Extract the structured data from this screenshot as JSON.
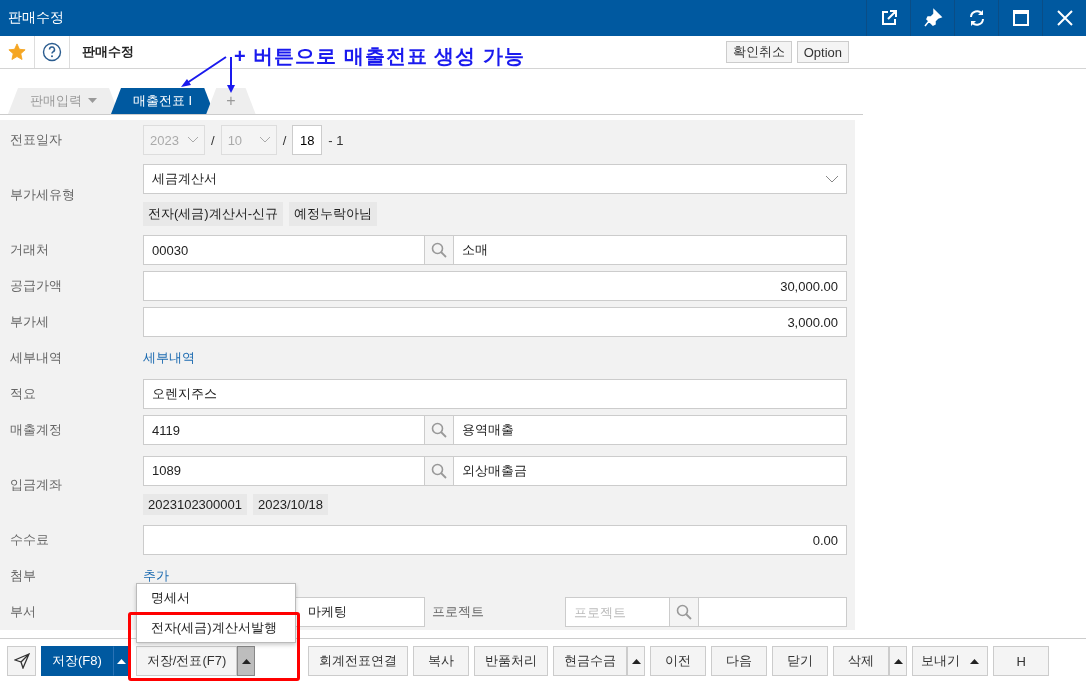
{
  "window": {
    "title": "판매수정"
  },
  "toolbar": {
    "favorite": true,
    "title": "판매수정",
    "buttons": [
      "확인취소",
      "Option"
    ]
  },
  "annotation": {
    "text": "+ 버튼으로 매출전표 생성 가능"
  },
  "tabs": [
    {
      "label": "판매입력",
      "selected": false,
      "kind": "dropdown"
    },
    {
      "label": "매출전표 I",
      "selected": true,
      "kind": "plain"
    },
    {
      "label": "+",
      "selected": false,
      "kind": "add"
    }
  ],
  "form": [
    {
      "kind": "date",
      "label": "전표일자",
      "year": "2023",
      "month": "10",
      "day": "18",
      "separator": "/",
      "suffix": "- 1"
    },
    {
      "kind": "select",
      "label": "부가세유형",
      "value": "세금계산서",
      "chips": [
        "전자(세금)계산서-신규",
        "예정누락아님"
      ]
    },
    {
      "kind": "lookup",
      "label": "거래처",
      "code": "00030",
      "name": "소매"
    },
    {
      "kind": "amount",
      "label": "공급가액",
      "value": "30,000.00"
    },
    {
      "kind": "amount",
      "label": "부가세",
      "value": "3,000.00"
    },
    {
      "kind": "link",
      "label": "세부내역",
      "value": "세부내역"
    },
    {
      "kind": "text",
      "label": "적요",
      "value": "오렌지주스"
    },
    {
      "kind": "lookup",
      "label": "매출계정",
      "code": "4119",
      "name": "용역매출"
    },
    {
      "kind": "lookup",
      "label": "입금계좌",
      "code": "1089",
      "name": "외상매출금",
      "chips": [
        "2023102300001",
        "2023/10/18"
      ]
    },
    {
      "kind": "amount",
      "label": "수수료",
      "value": "0.00"
    },
    {
      "kind": "link",
      "label": "첨부",
      "value": "추가"
    },
    {
      "kind": "dept",
      "label": "부서",
      "value": "마케팅",
      "project_label": "프로젝트",
      "project_placeholder": "프로젝트"
    }
  ],
  "popup_menu": {
    "items": [
      "명세서",
      "전자(세금)계산서발행"
    ]
  },
  "footer_buttons": [
    {
      "kind": "icon"
    },
    {
      "kind": "split",
      "label": "저장(F8)",
      "primary": true,
      "menu_open": false
    },
    {
      "kind": "split",
      "label": "저장/전표(F7)",
      "primary": false,
      "menu_open": true
    },
    {
      "kind": "plain",
      "label": "회계전표연결",
      "primary": false
    },
    {
      "kind": "plain",
      "label": "복사",
      "primary": false
    },
    {
      "kind": "plain",
      "label": "반품처리",
      "primary": false
    },
    {
      "kind": "split",
      "label": "현금수금",
      "primary": false,
      "menu_open": false
    },
    {
      "kind": "plain",
      "label": "이전",
      "primary": false
    },
    {
      "kind": "plain",
      "label": "다음",
      "primary": false
    },
    {
      "kind": "plain",
      "label": "닫기",
      "primary": false
    },
    {
      "kind": "split",
      "label": "삭제",
      "primary": false,
      "menu_open": false
    },
    {
      "kind": "menu",
      "label": "보내기",
      "primary": false
    },
    {
      "kind": "plain",
      "label": "H",
      "primary": false
    }
  ]
}
